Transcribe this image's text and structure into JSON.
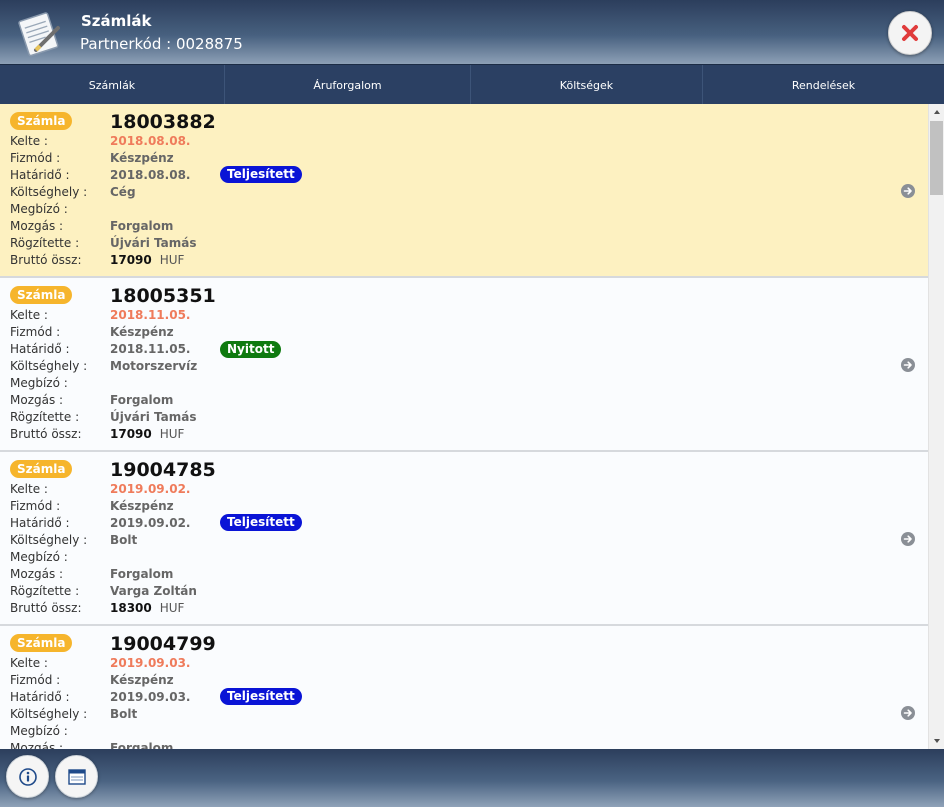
{
  "header": {
    "title": "Számlák",
    "subtitle": "Partnerkód : 0028875",
    "logo_icon": "notepad-pencil-icon",
    "close_icon": "close-x-icon"
  },
  "tabs": [
    {
      "label": "Számlák"
    },
    {
      "label": "Áruforgalom"
    },
    {
      "label": "Költségek"
    },
    {
      "label": "Rendelések"
    }
  ],
  "labels": {
    "kelte": "Kelte :",
    "fizmod": "Fizmód :",
    "hatarido": "Határidő :",
    "koltseghely": "Költséghely :",
    "megbizo": "Megbízó :",
    "mozgas": "Mozgás :",
    "rogzitette": "Rögzítette :",
    "brutto": "Bruttó össz:"
  },
  "invoices": [
    {
      "type": "Számla",
      "number": "18003882",
      "kelte": "2018.08.08.",
      "fizmod": "Készpénz",
      "hatarido": "2018.08.08.",
      "koltseghely": "Cég",
      "megbizo": "",
      "mozgas": "Forgalom",
      "rogzitette": "Újvári Tamás",
      "brutto": "17090",
      "currency": "HUF",
      "status": "Teljesített",
      "status_color": "#0a14d6",
      "selected": true
    },
    {
      "type": "Számla",
      "number": "18005351",
      "kelte": "2018.11.05.",
      "fizmod": "Készpénz",
      "hatarido": "2018.11.05.",
      "koltseghely": "Motorszervíz",
      "megbizo": "",
      "mozgas": "Forgalom",
      "rogzitette": "Újvári Tamás",
      "brutto": "17090",
      "currency": "HUF",
      "status": "Nyitott",
      "status_color": "#0f7a10",
      "selected": false
    },
    {
      "type": "Számla",
      "number": "19004785",
      "kelte": "2019.09.02.",
      "fizmod": "Készpénz",
      "hatarido": "2019.09.02.",
      "koltseghely": "Bolt",
      "megbizo": "",
      "mozgas": "Forgalom",
      "rogzitette": "Varga Zoltán",
      "brutto": "18300",
      "currency": "HUF",
      "status": "Teljesített",
      "status_color": "#0a14d6",
      "selected": false
    },
    {
      "type": "Számla",
      "number": "19004799",
      "kelte": "2019.09.03.",
      "fizmod": "Készpénz",
      "hatarido": "2019.09.03.",
      "koltseghely": "Bolt",
      "megbizo": "",
      "mozgas": "Forgalom",
      "rogzitette": "",
      "brutto": "",
      "currency": "",
      "status": "Teljesített",
      "status_color": "#0a14d6",
      "selected": false
    }
  ],
  "footer": {
    "info_icon": "info-icon",
    "calendar_icon": "calendar-icon"
  },
  "colors": {
    "header_bg": "#2c3e5c",
    "tab_bg": "#2b4063",
    "selected_card": "#fdf1c1",
    "type_badge": "#f6b52c",
    "date_text": "#ef7b5b"
  }
}
